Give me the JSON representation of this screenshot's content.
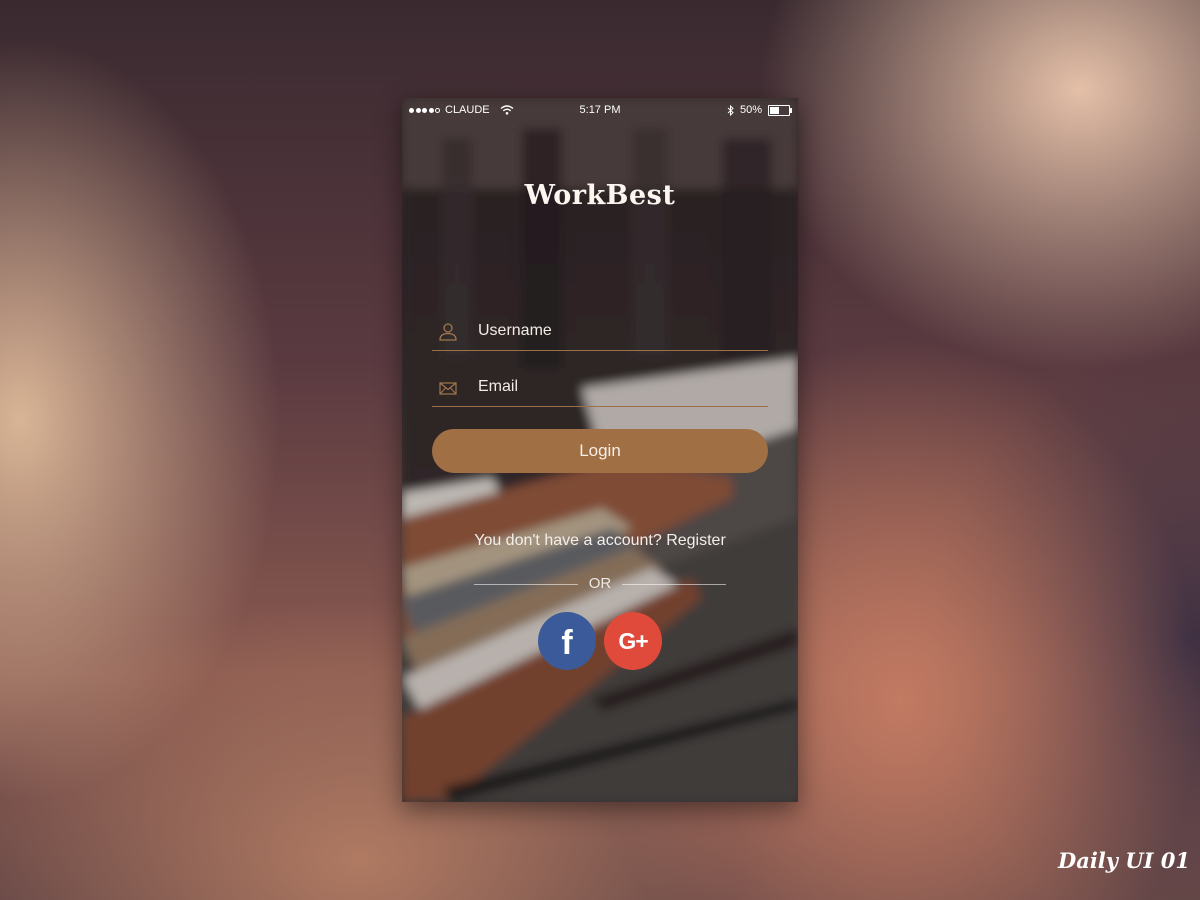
{
  "status_bar": {
    "carrier": "CLAUDE",
    "time": "5:17 PM",
    "battery_percent": "50%",
    "battery_level": 0.5,
    "signal_bars_filled": 4,
    "signal_bars_total": 5
  },
  "app": {
    "title": "WorkBest"
  },
  "form": {
    "username_placeholder": "Username",
    "email_placeholder": "Email",
    "username_value": "",
    "email_value": "",
    "login_label": "Login"
  },
  "footer": {
    "register_text": "You don't have a account? Register",
    "or_text": "OR"
  },
  "social": {
    "facebook_glyph": "f",
    "google_glyph": "G+",
    "facebook_color": "#3b5a9a",
    "google_color": "#df4a3a"
  },
  "icons": {
    "user_icon": "user-outline",
    "email_icon": "envelope-outline",
    "wifi_icon": "wifi",
    "bluetooth_icon": "bluetooth",
    "battery_icon": "battery"
  },
  "colors": {
    "accent": "#a06f44",
    "field_underline": "#9b7147"
  },
  "watermark": "Daily UI 01"
}
